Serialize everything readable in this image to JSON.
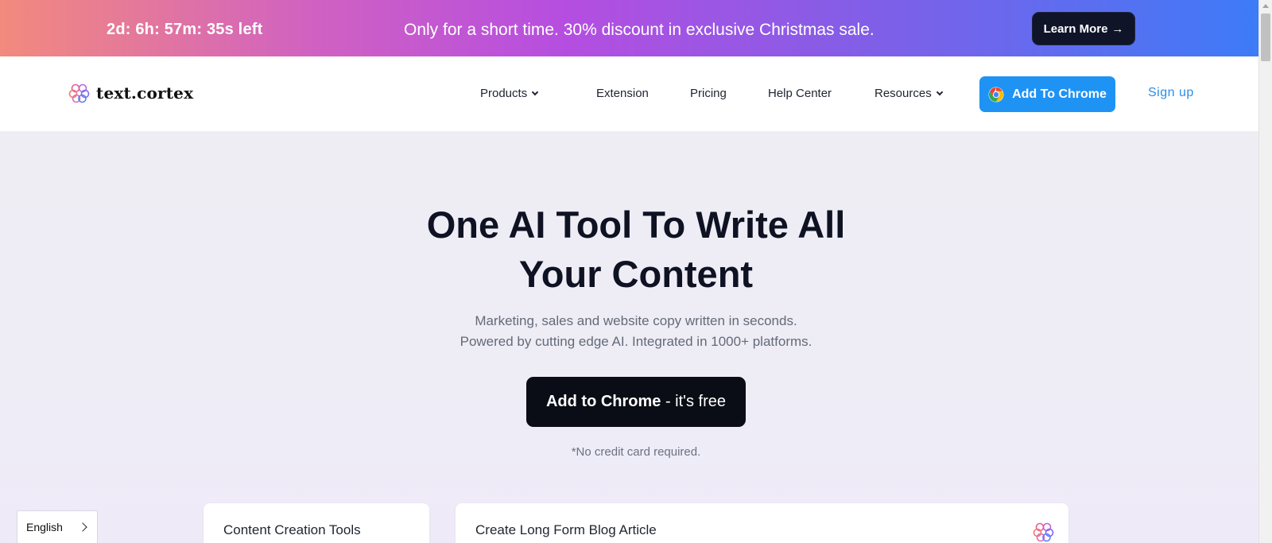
{
  "promo": {
    "countdown": "2d: 6h: 57m: 35s left",
    "message": "Only for a short time. 30% discount in exclusive Christmas sale.",
    "learn_more": "Learn More",
    "learn_more_arrow": "→"
  },
  "nav": {
    "logo_text": "text.cortex",
    "logo_icon": "brain-logo-icon",
    "items": {
      "products": "Products",
      "extension": "Extension",
      "pricing": "Pricing",
      "help_center": "Help Center",
      "resources": "Resources"
    },
    "add_to_chrome": "Add To Chrome",
    "chrome_icon": "chrome-icon",
    "sign_up": "Sign up"
  },
  "hero": {
    "title_line1": "One AI Tool To Write All",
    "title_line2": "Your Content",
    "subtitle_line1": "Marketing, sales and website copy written in seconds.",
    "subtitle_line2": "Powered by cutting edge AI. Integrated in 1000+ platforms.",
    "cta_bold": "Add to Chrome",
    "cta_rest": " - it's free",
    "no_credit_card": "*No credit card required."
  },
  "cards": {
    "content_creation": "Content Creation Tools",
    "long_form": "Create Long Form Blog Article"
  },
  "language": {
    "selected": "English"
  },
  "colors": {
    "primary_blue": "#1e93f4",
    "dark": "#0b0d16",
    "link_blue": "#2b8ee8"
  }
}
